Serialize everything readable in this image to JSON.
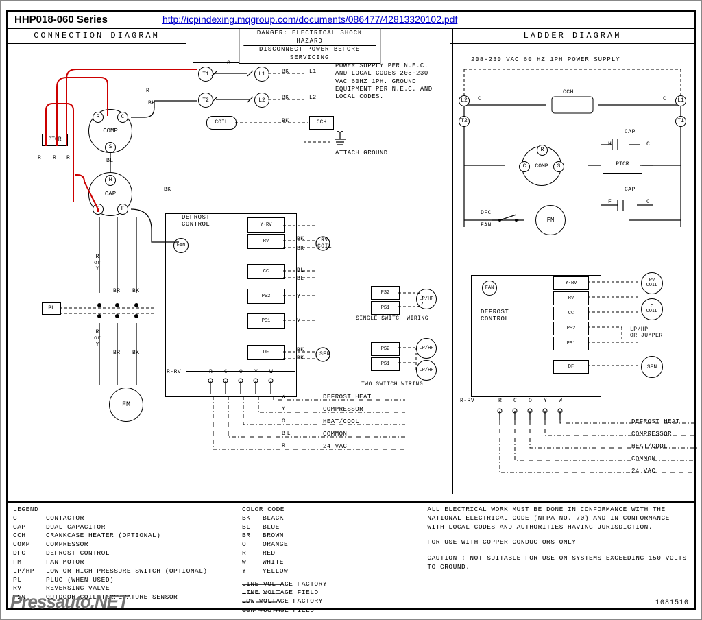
{
  "header": {
    "series": "HHP018-060 Series",
    "url": "http://icpindexing.mqgroup.com/documents/086477/42813320102.pdf"
  },
  "titles": {
    "connection": "CONNECTION   DIAGRAM",
    "ladder": "LADDER   DIAGRAM",
    "danger1": "DANGER: ELECTRICAL SHOCK HAZARD",
    "danger2": "DISCONNECT POWER BEFORE SERVICING"
  },
  "supply_note": "POWER SUPPLY PER N.E.C. AND LOCAL CODES 208-230 VAC 60HZ 1PH. GROUND EQUIPMENT PER N.E.C. AND LOCAL CODES.",
  "attach_ground": "ATTACH GROUND",
  "ladder_supply": "208-230 VAC 60 HZ 1PH POWER SUPPLY",
  "labels": {
    "PTCR": "PTCR",
    "COMP": "COMP",
    "CAP": "CAP",
    "COIL": "COIL",
    "CCH": "CCH",
    "FM": "FM",
    "FAN": "FAN",
    "PL": "PL",
    "BL": "BL",
    "BK": "BK",
    "R": "R",
    "BR": "BR",
    "RorY": "R\nor\nY",
    "brY": "or\nY",
    "C": "C",
    "L1": "L1",
    "L2": "L2",
    "T1": "T1",
    "T2": "T2",
    "S": "S",
    "H": "H",
    "F": "F",
    "DFC": "DFC",
    "RVCOIL": "RV\nCOIL",
    "CCOIL": "C\nCOIL",
    "SEN": "SEN",
    "LPHP": "LP/HP",
    "LPHP_JUMPER": "LP/HP\nOR JUMPER",
    "PS1": "PS1",
    "PS2": "PS2",
    "CC": "CC",
    "RV": "RV",
    "DF": "DF",
    "YRV": "Y-RV",
    "DEFCTL": "DEFROST\nCONTROL",
    "RRV": "R-RV",
    "O": "O",
    "Y": "Y",
    "W": "W",
    "single_switch": "SINGLE SWITCH WIRING",
    "two_switch": "TWO SWITCH WIRING"
  },
  "thermo_labels": [
    "DEFROST HEAT",
    "COMPRESSOR",
    "HEAT/COOL",
    "COMMON",
    "24 VAC"
  ],
  "legend_title": "LEGEND",
  "legend_items": [
    [
      "C",
      "CONTACTOR"
    ],
    [
      "CAP",
      "DUAL CAPACITOR"
    ],
    [
      "CCH",
      "CRANKCASE HEATER (OPTIONAL)"
    ],
    [
      "COMP",
      "COMPRESSOR"
    ],
    [
      "DFC",
      "DEFROST CONTROL"
    ],
    [
      "FM",
      "FAN MOTOR"
    ],
    [
      "LP/HP",
      "LOW OR HIGH PRESSURE SWITCH (OPTIONAL)"
    ],
    [
      "PL",
      "PLUG (WHEN USED)"
    ],
    [
      "RV",
      "REVERSING VALVE"
    ],
    [
      "SEN",
      "OUTDOOR COIL TEMPERATURE SENSOR"
    ]
  ],
  "color_code_title": "COLOR CODE",
  "color_codes": [
    [
      "BK",
      "BLACK"
    ],
    [
      "BL",
      "BLUE"
    ],
    [
      "BR",
      "BROWN"
    ],
    [
      "O",
      "ORANGE"
    ],
    [
      "R",
      "RED"
    ],
    [
      "W",
      "WHITE"
    ],
    [
      "Y",
      "YELLOW"
    ]
  ],
  "line_types": [
    "LINE VOLTAGE FACTORY",
    "LINE VOLTAGE FIELD",
    "LOW VOLTAGE FACTORY",
    "LOW VOLTAGE FIELD"
  ],
  "notes": {
    "conformance": "ALL ELECTRICAL WORK MUST BE DONE IN CONFORMANCE WITH THE NATIONAL ELECTRICAL CODE (NFPA NO. 70) AND IN CONFORMANCE WITH LOCAL CODES AND AUTHORITIES HAVING JURISDICTION.",
    "copper": "FOR USE WITH COPPER CONDUCTORS ONLY",
    "caution": "CAUTION : NOT SUITABLE FOR USE ON SYSTEMS EXCEEDING 150 VOLTS TO GROUND."
  },
  "partno": "1081510",
  "watermark": "Pressauto.NET"
}
